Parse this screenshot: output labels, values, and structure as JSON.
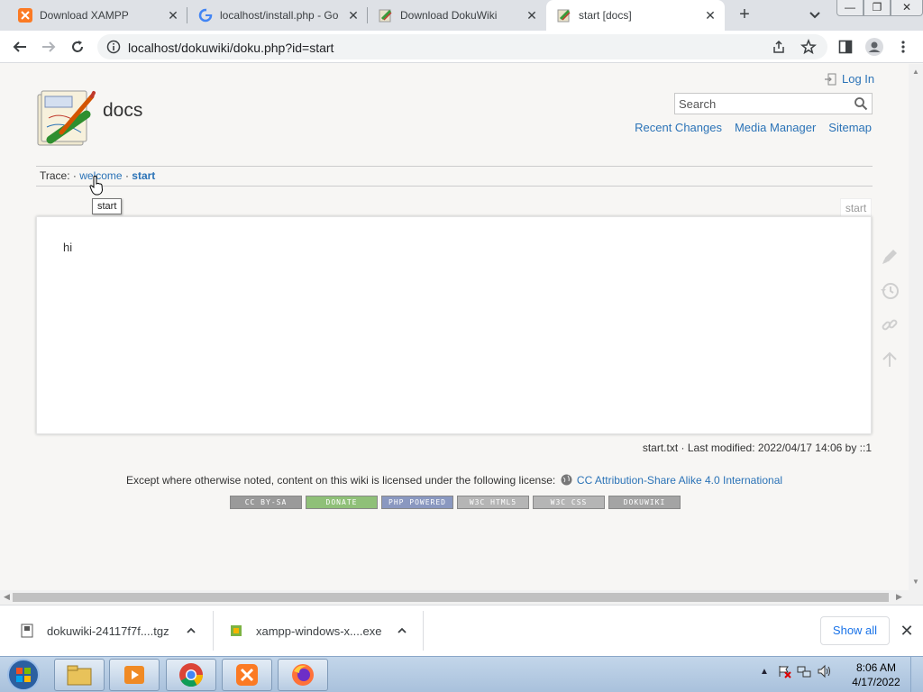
{
  "browser": {
    "tabs": [
      {
        "title": "Download XAMPP",
        "icon": "xampp-icon"
      },
      {
        "title": "localhost/install.php - Go",
        "icon": "google-icon"
      },
      {
        "title": "Download DokuWiki",
        "icon": "dokuwiki-icon"
      },
      {
        "title": "start [docs]",
        "icon": "dokuwiki-icon",
        "active": true
      }
    ],
    "url": "localhost/dokuwiki/doku.php?id=start"
  },
  "page": {
    "site_title": "docs",
    "login_label": "Log In",
    "search_placeholder": "Search",
    "tools": {
      "recent_changes": "Recent Changes",
      "media_manager": "Media Manager",
      "sitemap": "Sitemap"
    },
    "trace": {
      "label": "Trace:",
      "sep": "·",
      "crumbs": [
        "welcome",
        "start"
      ]
    },
    "tooltip": "start",
    "page_id_tab": "start",
    "content_text": "hi",
    "docinfo": "start.txt · Last modified: 2022/04/17 14:06 by ::1",
    "license_text": "Except where otherwise noted, content on this wiki is licensed under the following license:",
    "license_link": "CC Attribution-Share Alike 4.0 International",
    "badges": [
      "CC BY-SA",
      "DONATE",
      "PHP POWERED",
      "W3C HTML5",
      "W3C CSS",
      "DOKUWIKI"
    ]
  },
  "downloads": {
    "items": [
      "dokuwiki-24117f7f....tgz",
      "xampp-windows-x....exe"
    ],
    "show_all": "Show all"
  },
  "taskbar": {
    "time": "8:06 AM",
    "date": "4/17/2022"
  },
  "colors": {
    "link": "#2b73b7",
    "page_bg": "#f7f6f4"
  }
}
